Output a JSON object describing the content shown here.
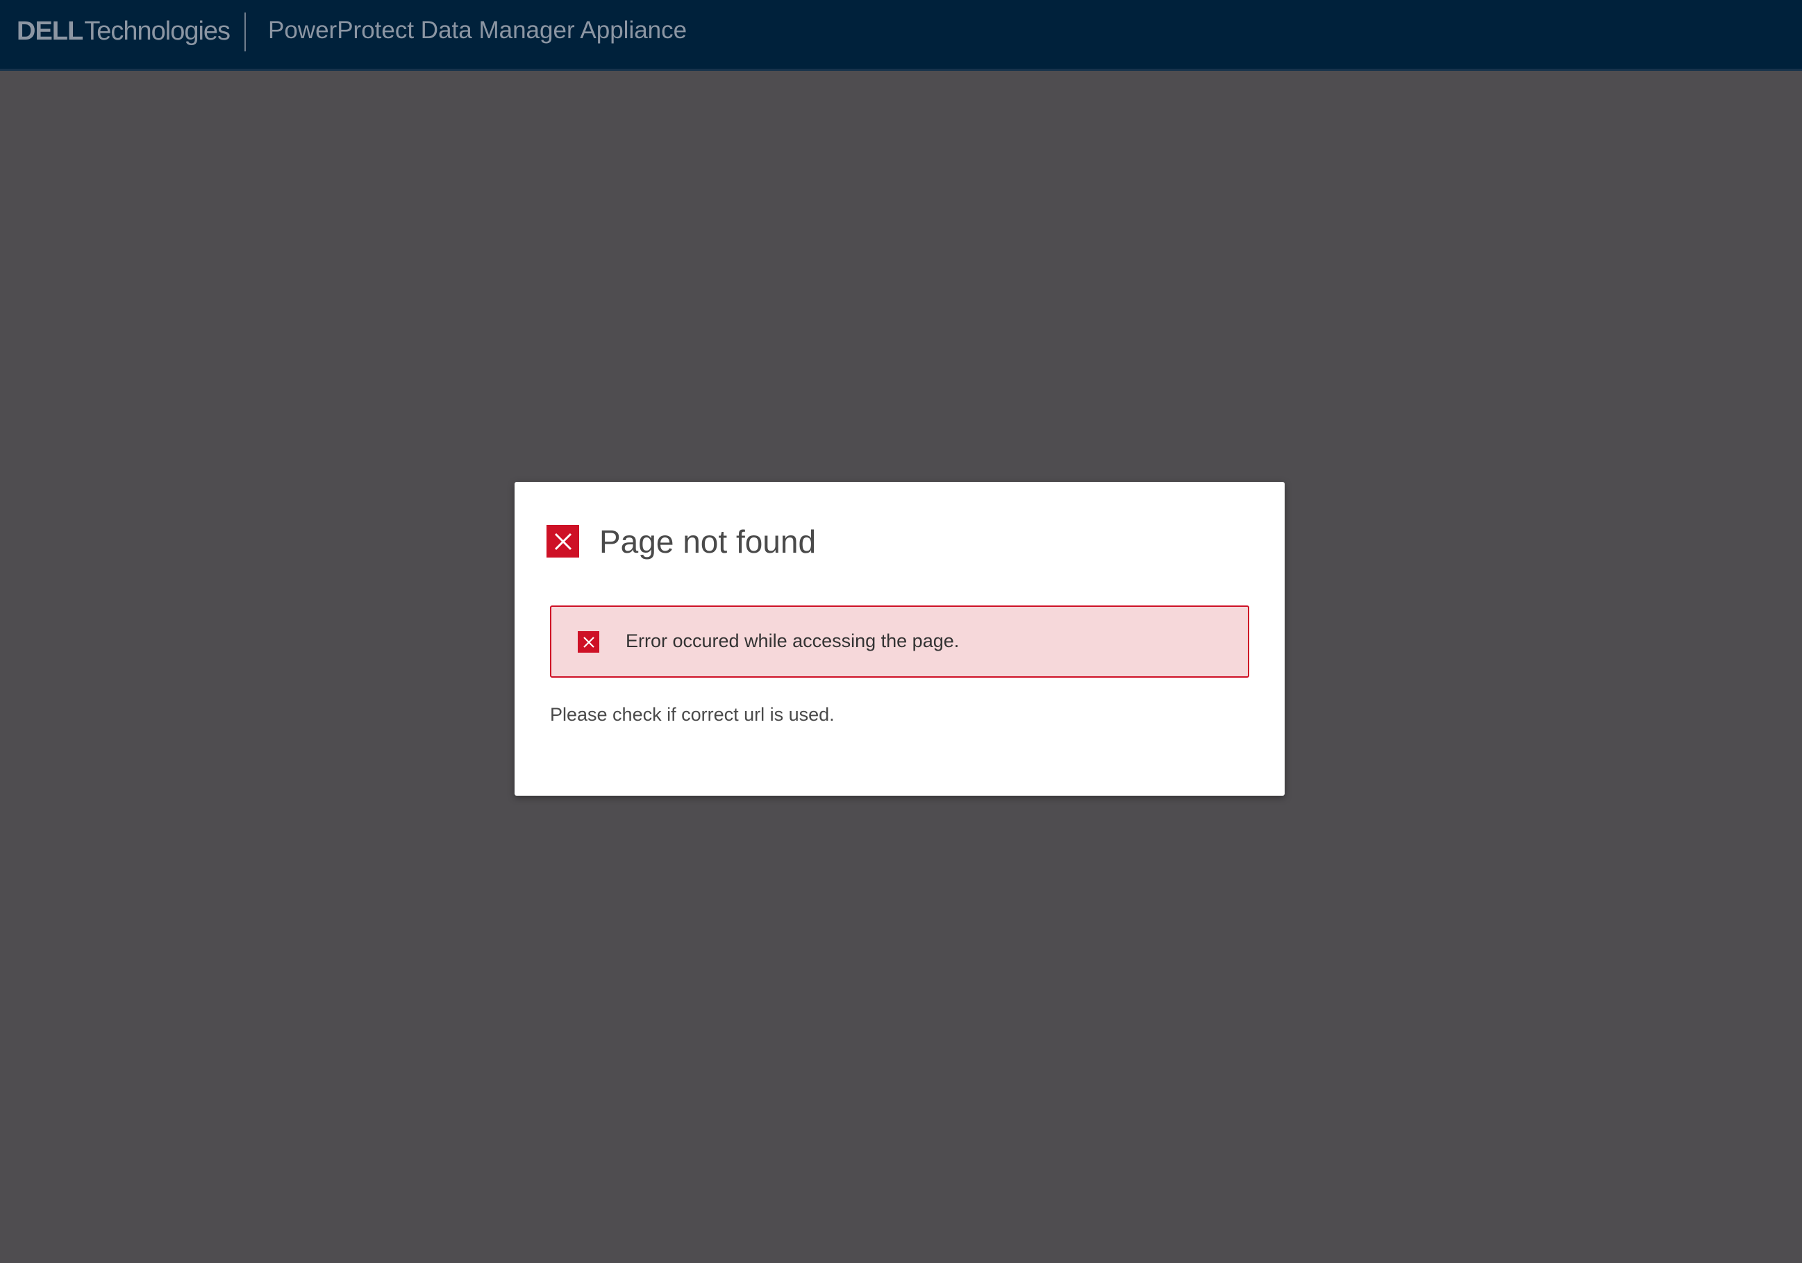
{
  "header": {
    "brand_bold": "DELL",
    "brand_light": "Technologies",
    "app_title": "PowerProtect Data Manager Appliance"
  },
  "dialog": {
    "title": "Page not found",
    "alert_message": "Error occured while accessing the page.",
    "help_text": "Please check if correct url is used."
  },
  "icons": {
    "title_icon": "close-x-icon",
    "alert_icon": "close-x-icon"
  },
  "colors": {
    "header_bg": "#00213b",
    "page_bg": "#4f4d50",
    "error_red": "#ce1126",
    "alert_bg": "#f6d8da"
  }
}
